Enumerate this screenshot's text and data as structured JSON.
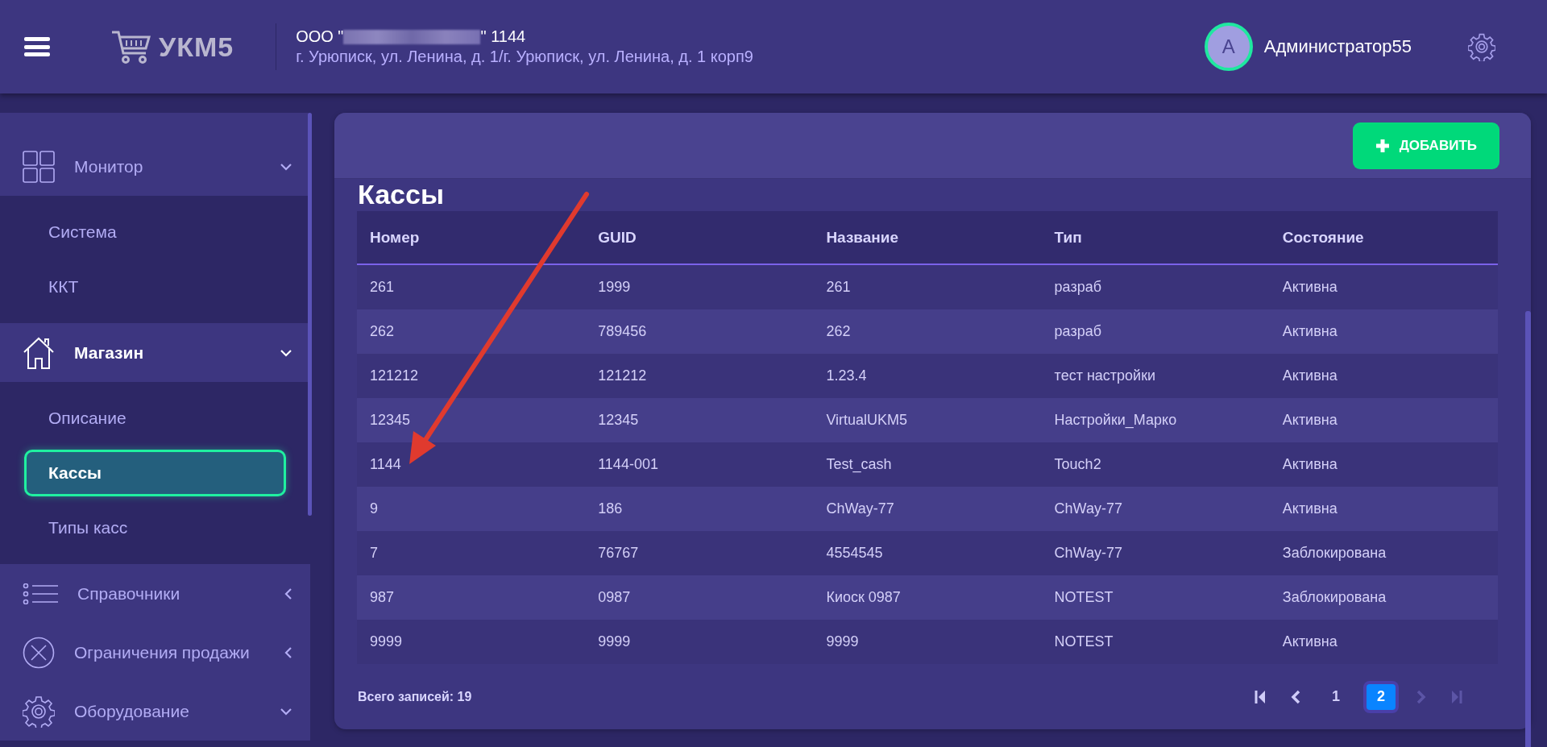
{
  "header": {
    "logo_text": "УКМ5",
    "company_prefix": "ООО \"",
    "company_suffix": "\" 1144",
    "address": "г. Урюписк, ул. Ленина, д. 1/г. Урюписк, ул. Ленина, д. 1 корп9",
    "avatar_letter": "А",
    "user_name": "Администратор55"
  },
  "sidebar": {
    "groups": [
      {
        "label": "Монитор",
        "expanded": true,
        "active": false,
        "children": [
          {
            "label": "Система",
            "selected": false
          },
          {
            "label": "ККТ",
            "selected": false
          }
        ]
      },
      {
        "label": "Магазин",
        "expanded": true,
        "active": true,
        "children": [
          {
            "label": "Описание",
            "selected": false
          },
          {
            "label": "Кассы",
            "selected": true
          },
          {
            "label": "Типы касс",
            "selected": false
          }
        ]
      },
      {
        "label": "Справочники",
        "expanded": false,
        "active": false
      },
      {
        "label": "Ограничения продажи",
        "expanded": false,
        "active": false
      },
      {
        "label": "Оборудование",
        "expanded": true,
        "active": false
      }
    ]
  },
  "add_button": "ДОБАВИТЬ",
  "page_title": "Кассы",
  "table": {
    "columns": [
      "Номер",
      "GUID",
      "Название",
      "Тип",
      "Состояние"
    ],
    "rows": [
      [
        "261",
        "1999",
        "261",
        "разраб",
        "Активна"
      ],
      [
        "262",
        "789456",
        "262",
        "разраб",
        "Активна"
      ],
      [
        "121212",
        "121212",
        "1.23.4",
        "тест настройки",
        "Активна"
      ],
      [
        "12345",
        "12345",
        "VirtualUKM5",
        "Настройки_Марко",
        "Активна"
      ],
      [
        "1144",
        "1144-001",
        "Test_cash",
        "Touch2",
        "Активна"
      ],
      [
        "9",
        "186",
        "ChWay-77",
        "ChWay-77",
        "Активна"
      ],
      [
        "7",
        "76767",
        "4554545",
        "ChWay-77",
        "Заблокирована"
      ],
      [
        "987",
        "0987",
        "Киоск 0987",
        "NOTEST",
        "Заблокирована"
      ],
      [
        "9999",
        "9999",
        "9999",
        "NOTEST",
        "Активна"
      ]
    ]
  },
  "total": "Всего записей: 19",
  "pagination": {
    "first_disabled": false,
    "prev_disabled": false,
    "pages": [
      {
        "label": "1",
        "selected": false
      },
      {
        "label": "2",
        "selected": true
      }
    ],
    "next_disabled": true,
    "last_disabled": true
  }
}
